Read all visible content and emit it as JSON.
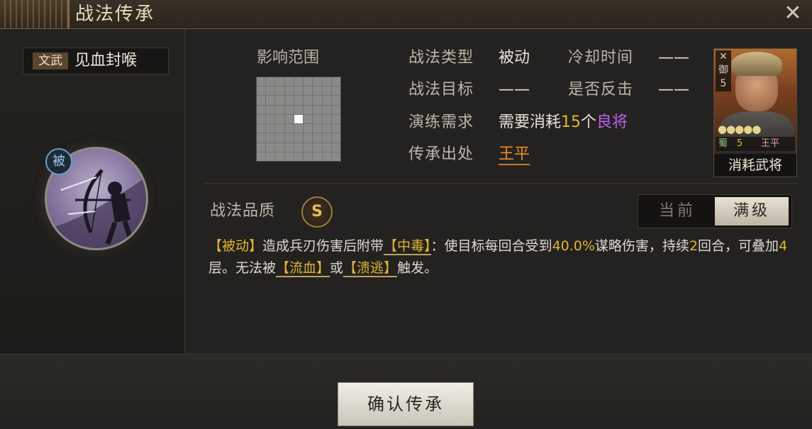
{
  "window": {
    "title": "战法传承",
    "close_glyph": "✕"
  },
  "skill": {
    "tag": "文武",
    "name": "见血封喉",
    "passive_badge": "被"
  },
  "range": {
    "label": "影响范围",
    "grid_size": 9,
    "active_cell": [
      4,
      4
    ]
  },
  "info": {
    "type_label": "战法类型",
    "type_value": "被动",
    "cooldown_label": "冷却时间",
    "cooldown_value": "——",
    "target_label": "战法目标",
    "target_value": "——",
    "counter_label": "是否反击",
    "counter_value": "——",
    "req_label": "演练需求",
    "req_prefix": "需要消耗",
    "req_count": "15",
    "req_unit": "个",
    "req_rarity": "良将",
    "source_label": "传承出处",
    "source_value": "王平"
  },
  "general": {
    "unit_type": "御",
    "level": "5",
    "stars": "●●●●●",
    "faction": "蜀",
    "cost": "5",
    "name": "王平",
    "action_label": "消耗武将"
  },
  "quality": {
    "label": "战法品质",
    "grade": "S"
  },
  "level_toggle": {
    "current": "当前",
    "max": "满级",
    "selected": "max"
  },
  "description": {
    "p1": "【被动】",
    "p2": "造成兵刃伤害后附带",
    "p3": "【中毒】",
    "p4": "：使目标每回合受到",
    "p5": "40.0%",
    "p6": "谋略伤害，",
    "p7": "持续",
    "p8": "2",
    "p9": "回合，可叠加",
    "p10": "4",
    "p11": "层。无法被",
    "p12": "【流血】",
    "p13": "或",
    "p14": "【溃逃】",
    "p15": "触发。"
  },
  "confirm_label": "确认传承",
  "colors": {
    "accent_gold": "#e2b52f",
    "rarity_purple": "#c45df0",
    "source_orange": "#f08a2a"
  }
}
